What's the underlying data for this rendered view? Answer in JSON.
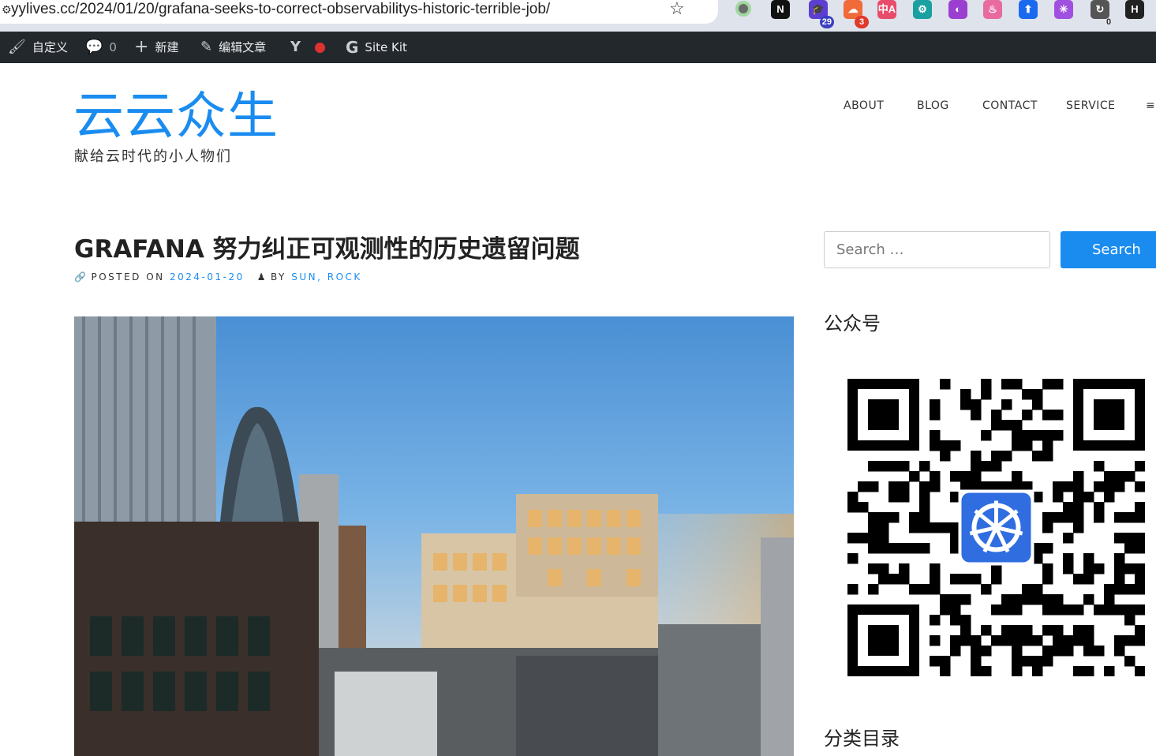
{
  "browser": {
    "url": "yylives.cc/2024/01/20/grafana-seeks-to-correct-observabilitys-historic-terrible-job/",
    "extensions": [
      {
        "name": "green-dot-extension-icon",
        "label": "",
        "badge": "",
        "color": "#6a6a6a"
      },
      {
        "name": "notion-icon",
        "label": "N",
        "badge": "",
        "color": "#111111"
      },
      {
        "name": "graduation-cap-extension-icon",
        "label": "🎓",
        "badge": "29",
        "color": "#5b3fd0"
      },
      {
        "name": "cloud-extension-icon",
        "label": "☁",
        "badge": "3",
        "color": "#f06a3a"
      },
      {
        "name": "translate-extension-icon",
        "label": "中A",
        "badge": "",
        "color": "#e84c6a"
      },
      {
        "name": "brain-extension-icon",
        "label": "⚙",
        "badge": "",
        "color": "#1aa0a0"
      },
      {
        "name": "purple-circle-extension-icon",
        "label": "◐",
        "badge": "",
        "color": "#9b3fd0"
      },
      {
        "name": "pink-extension-icon",
        "label": "♨",
        "badge": "",
        "color": "#e86aa0"
      },
      {
        "name": "blue-arrow-extension-icon",
        "label": "⬆",
        "badge": "",
        "color": "#1a6af0"
      },
      {
        "name": "openai-icon",
        "label": "✳",
        "badge": "",
        "color": "#a050e0"
      },
      {
        "name": "refresh-extension-icon",
        "label": "↻",
        "badge": "0",
        "color": "#555555"
      },
      {
        "name": "dark-extension-icon",
        "label": "H",
        "badge": "",
        "color": "#222222"
      }
    ]
  },
  "admin_bar": {
    "customize": "自定义",
    "comments_count": "0",
    "new": "新建",
    "edit_post": "编辑文章",
    "site_kit": "Site Kit"
  },
  "site": {
    "title": "云云众生",
    "description": "献给云时代的小人物们"
  },
  "nav": {
    "items": [
      "ABOUT",
      "BLOG",
      "CONTACT",
      "SERVICE"
    ],
    "toggle": "≡"
  },
  "post": {
    "title": "GRAFANA 努力纠正可观测性的历史遗留问题",
    "posted_on_label": "POSTED ON",
    "date": "2024-01-20",
    "by_label": "BY",
    "authors": "SUN, ROCK"
  },
  "sidebar": {
    "search_placeholder": "Search …",
    "search_button": "Search",
    "widget_wechat": "公众号",
    "widget_categories": "分类目录"
  },
  "colors": {
    "accent": "#1a8cf0",
    "admin_bar": "#23282d"
  }
}
